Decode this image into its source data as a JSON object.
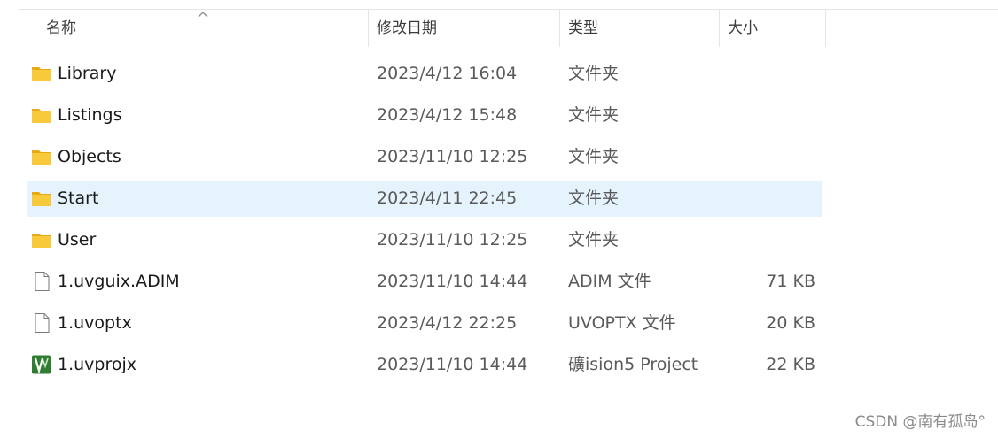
{
  "columns": {
    "name": "名称",
    "date": "修改日期",
    "type": "类型",
    "size": "大小"
  },
  "files": [
    {
      "name": "Library",
      "date": "2023/4/12 16:04",
      "type": "文件夹",
      "size": "",
      "icon": "folder-icon"
    },
    {
      "name": "Listings",
      "date": "2023/4/12 15:48",
      "type": "文件夹",
      "size": "",
      "icon": "folder-icon"
    },
    {
      "name": "Objects",
      "date": "2023/11/10 12:25",
      "type": "文件夹",
      "size": "",
      "icon": "folder-icon"
    },
    {
      "name": "Start",
      "date": "2023/4/11 22:45",
      "type": "文件夹",
      "size": "",
      "icon": "folder-icon",
      "selected": true
    },
    {
      "name": "User",
      "date": "2023/11/10 12:25",
      "type": "文件夹",
      "size": "",
      "icon": "folder-icon"
    },
    {
      "name": "1.uvguix.ADIM",
      "date": "2023/11/10 14:44",
      "type": "ADIM 文件",
      "size": "71 KB",
      "icon": "file-icon"
    },
    {
      "name": "1.uvoptx",
      "date": "2023/4/12 22:25",
      "type": "UVOPTX 文件",
      "size": "20 KB",
      "icon": "file-icon"
    },
    {
      "name": "1.uvprojx",
      "date": "2023/11/10 14:44",
      "type": "礦ision5 Project",
      "size": "22 KB",
      "icon": "keil-project-icon"
    }
  ],
  "colors": {
    "selected_row": "#e5f3fd",
    "folder": "#f8c93a",
    "keil_green": "#2e7d32"
  },
  "watermark": "CSDN @南有孤岛°"
}
